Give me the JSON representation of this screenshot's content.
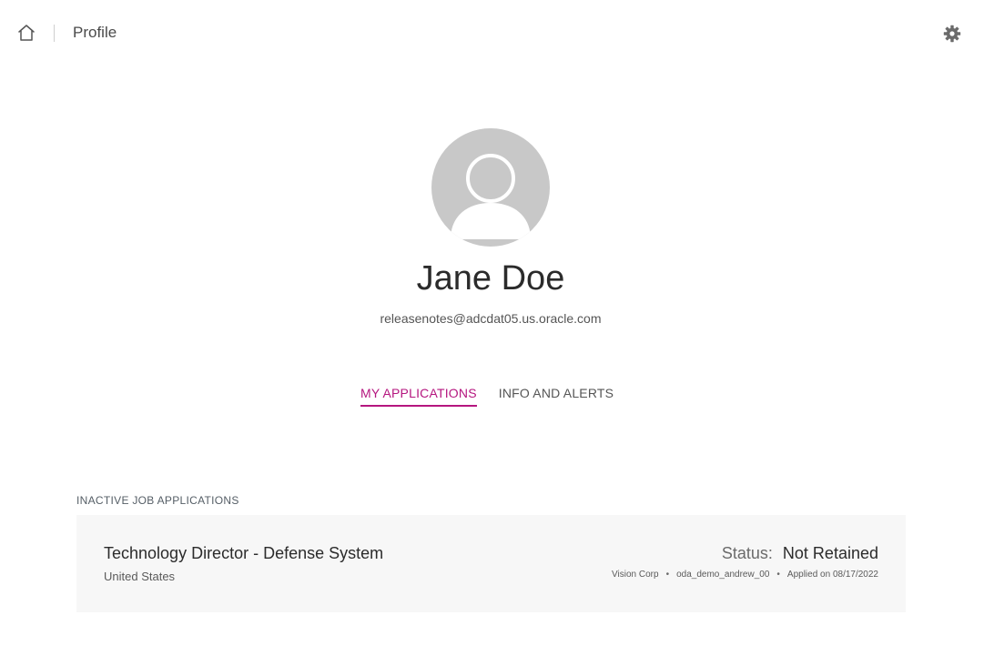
{
  "header": {
    "title": "Profile",
    "home_icon": "home-icon",
    "settings_icon": "gear-icon"
  },
  "profile": {
    "name": "Jane Doe",
    "email": "releasenotes@adcdat05.us.oracle.com",
    "avatar_icon": "avatar-placeholder-icon"
  },
  "tabs": [
    {
      "label": "MY APPLICATIONS",
      "active": true
    },
    {
      "label": "INFO AND ALERTS",
      "active": false
    }
  ],
  "applications": {
    "section_label": "INACTIVE JOB APPLICATIONS",
    "items": [
      {
        "title": "Technology Director - Defense System",
        "location": "United States",
        "status_label": "Status:",
        "status_value": "Not Retained",
        "company": "Vision Corp",
        "requisition": "oda_demo_andrew_00",
        "applied": "Applied on 08/17/2022",
        "separator": "•"
      }
    ]
  },
  "colors": {
    "accent": "#b5167f",
    "card_background": "#f7f7f7",
    "avatar_background": "#c8c8c8"
  }
}
